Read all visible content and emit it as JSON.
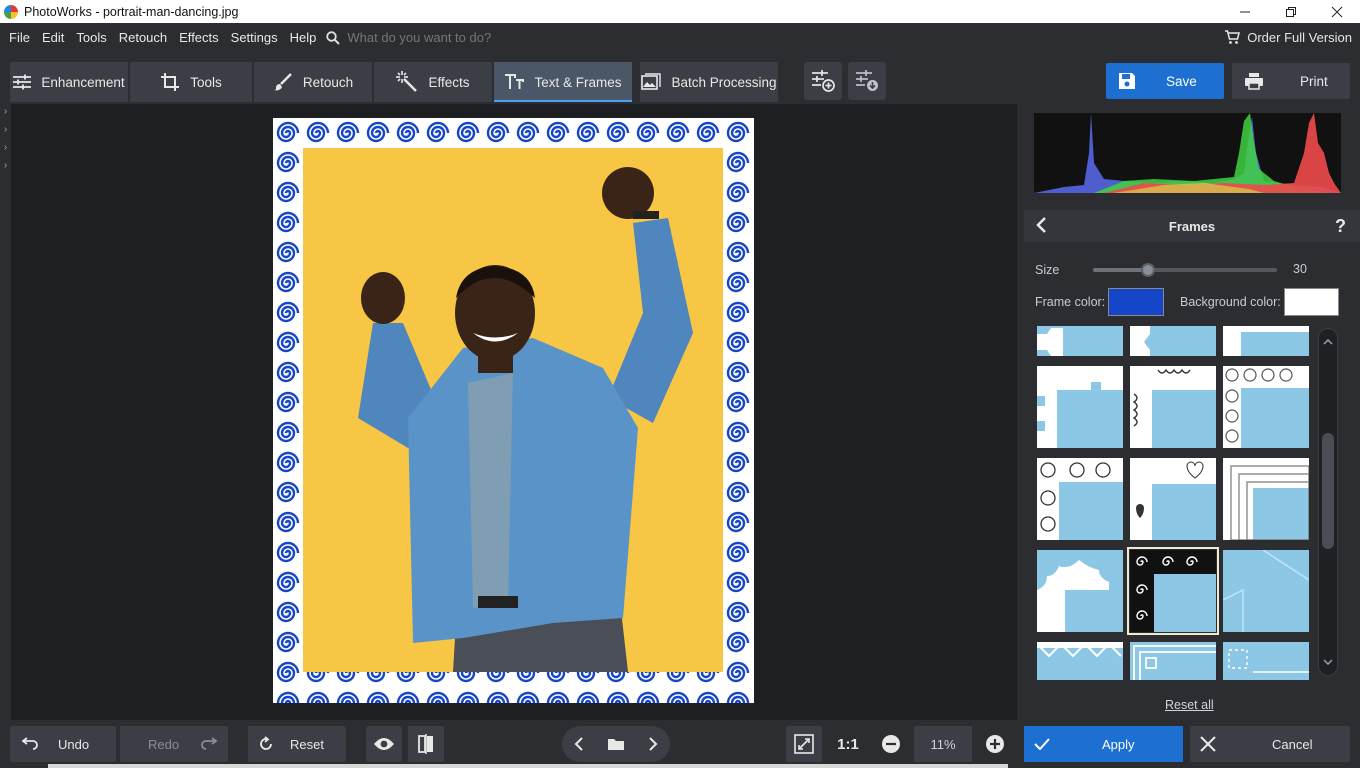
{
  "window": {
    "title": "PhotoWorks - portrait-man-dancing.jpg"
  },
  "menu": {
    "items": [
      "File",
      "Edit",
      "Tools",
      "Retouch",
      "Effects",
      "Settings",
      "Help"
    ],
    "search_placeholder": "What do you want to do?",
    "order_label": "Order Full Version"
  },
  "toolbar": {
    "tabs": [
      {
        "label": "Enhancement",
        "icon": "sliders-icon"
      },
      {
        "label": "Tools",
        "icon": "crop-icon"
      },
      {
        "label": "Retouch",
        "icon": "brush-icon"
      },
      {
        "label": "Effects",
        "icon": "magic-wand-icon"
      },
      {
        "label": "Text & Frames",
        "icon": "text-icon",
        "active": true
      },
      {
        "label": "Batch Processing",
        "icon": "image-icon"
      }
    ],
    "save_label": "Save",
    "print_label": "Print"
  },
  "panel": {
    "title": "Frames",
    "help": "?",
    "size_label": "Size",
    "size_value": "30",
    "size_level_fraction": 0.3,
    "frame_color_label": "Frame color:",
    "frame_color": "#1646c8",
    "background_color_label": "Background color:",
    "background_color": "#ffffff",
    "reset_all": "Reset all"
  },
  "bottom": {
    "undo_label": "Undo",
    "redo_label": "Redo",
    "reset_label": "Reset",
    "zoom_ratio": "1:1",
    "zoom_value": "11%",
    "apply_label": "Apply",
    "cancel_label": "Cancel"
  },
  "colors": {
    "accent": "#1d6fd1",
    "frame_blue": "#1646c8",
    "photo_background": "#f7c644",
    "thumbnail_blue": "#8cc8e6"
  }
}
